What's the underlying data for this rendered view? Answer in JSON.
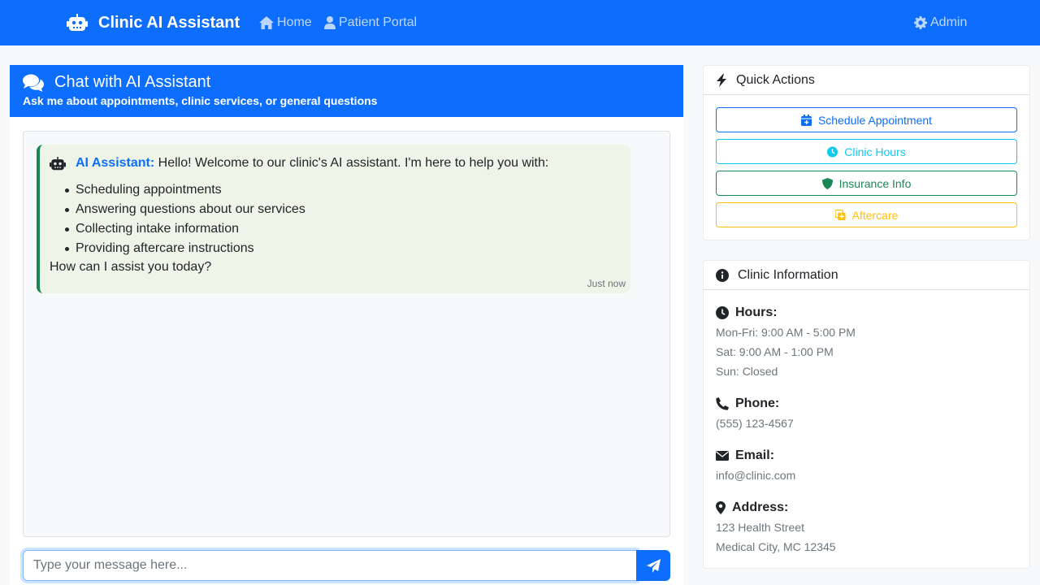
{
  "navbar": {
    "brand": "Clinic AI Assistant",
    "links": [
      {
        "label": "Home",
        "icon": "home-icon"
      },
      {
        "label": "Patient Portal",
        "icon": "user-icon"
      }
    ],
    "admin": {
      "label": "Admin",
      "icon": "gear-icon"
    }
  },
  "chat": {
    "title": "Chat with AI Assistant",
    "subtitle": "Ask me about appointments, clinic services, or general questions",
    "messages": [
      {
        "sender": "AI Assistant:",
        "intro": "Hello! Welcome to our clinic's AI assistant. I'm here to help you with:",
        "items": [
          "Scheduling appointments",
          "Answering questions about our services",
          "Collecting intake information",
          "Providing aftercare instructions"
        ],
        "closing": "How can I assist you today?",
        "time": "Just now"
      }
    ],
    "input": {
      "placeholder": "Type your message here...",
      "value": ""
    }
  },
  "quick_actions": {
    "title": "Quick Actions",
    "buttons": [
      {
        "label": "Schedule Appointment",
        "color": "#0d6efd",
        "icon": "calendar-plus-icon"
      },
      {
        "label": "Clinic Hours",
        "color": "#0dcaf0",
        "icon": "clock-icon"
      },
      {
        "label": "Insurance Info",
        "color": "#198754",
        "icon": "shield-icon"
      },
      {
        "label": "Aftercare",
        "color": "#ffc107",
        "icon": "copy-plus-icon"
      }
    ]
  },
  "clinic_info": {
    "title": "Clinic Information",
    "hours": {
      "label": "Hours:",
      "lines": [
        "Mon-Fri: 9:00 AM - 5:00 PM",
        "Sat: 9:00 AM - 1:00 PM",
        "Sun: Closed"
      ]
    },
    "phone": {
      "label": "Phone:",
      "value": "(555) 123-4567"
    },
    "email": {
      "label": "Email:",
      "value": "info@clinic.com"
    },
    "address": {
      "label": "Address:",
      "lines": [
        "123 Health Street",
        "Medical City, MC 12345"
      ]
    }
  },
  "colors": {
    "primary": "#0d6efd",
    "success": "#198754",
    "info": "#0dcaf0",
    "warning": "#ffc107"
  }
}
